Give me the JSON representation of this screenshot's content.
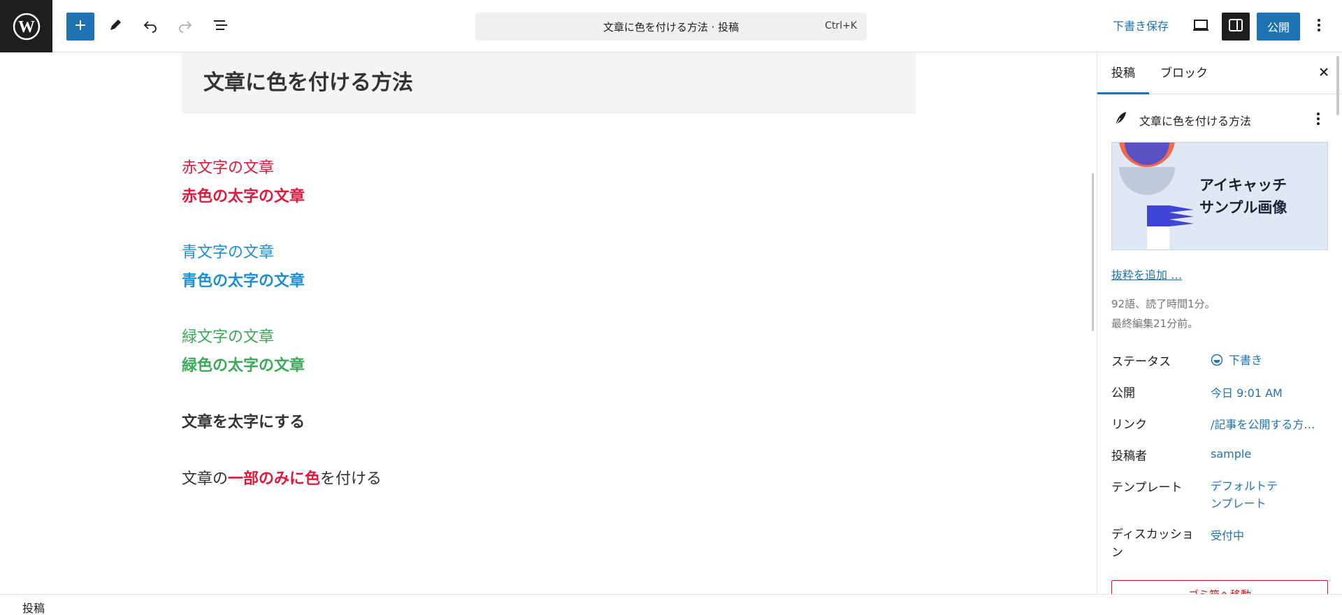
{
  "toolbar": {
    "command_title": "文章に色を付ける方法 · 投稿",
    "shortcut": "Ctrl+K",
    "save_draft_label": "下書き保存",
    "publish_label": "公開",
    "accent": "#1e73b3"
  },
  "icons": {
    "logo": "wordpress-icon",
    "add": "plus-icon",
    "tools": "pencil-icon",
    "undo": "undo-icon",
    "redo": "redo-icon",
    "outline": "list-view-icon",
    "preview": "laptop-icon",
    "settings": "sidebar-icon",
    "options": "more-vertical-icon"
  },
  "editor": {
    "post_title": "文章に色を付ける方法",
    "blocks": [
      {
        "text": "赤文字の文章"
      },
      {
        "text": "赤色の太字の文章"
      },
      {
        "text": "青文字の文章"
      },
      {
        "text": "青色の太字の文章"
      },
      {
        "text": "緑文字の文章"
      },
      {
        "text": "緑色の太字の文章"
      },
      {
        "text": "文章を太字にする"
      }
    ],
    "mixed": {
      "before": "文章の",
      "highlight": "一部のみに色",
      "after": "を付ける"
    },
    "colors": {
      "red": "#e2173b",
      "blue": "#1c8fd2",
      "green": "#3aa95a"
    }
  },
  "sidebar": {
    "tab_post": "投稿",
    "tab_block": "ブロック",
    "post_name": "文章に色を付ける方法",
    "featured_image_line1": "アイキャッチ",
    "featured_image_line2": "サンプル画像",
    "excerpt_link": "抜粋を追加 …",
    "word_info": "92語、読了時間1分。",
    "last_edited": "最終編集21分前。",
    "rows": [
      {
        "label": "ステータス",
        "value": "下書き"
      },
      {
        "label": "公開",
        "value": "今日 9:01 AM"
      },
      {
        "label": "リンク",
        "value": "/記事を公開する方…"
      },
      {
        "label": "投稿者",
        "value": "sample"
      },
      {
        "label": "テンプレート",
        "value": "デフォルトテンプレート"
      },
      {
        "label": "ディスカッション",
        "value": "受付中"
      }
    ],
    "trash_label": "ゴミ箱へ移動"
  },
  "footer": {
    "breadcrumb": "投稿"
  }
}
